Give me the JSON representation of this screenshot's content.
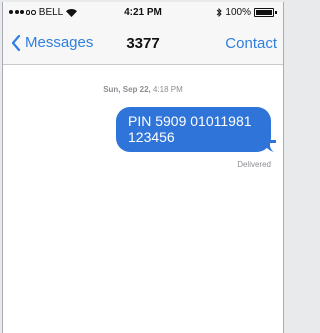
{
  "statusbar": {
    "carrier": "BELL",
    "time": "4:21 PM",
    "battery": "100%",
    "signal_bars": 3
  },
  "nav": {
    "back_label": "Messages",
    "title": "3377",
    "contact_label": "Contact"
  },
  "thread": {
    "timestamp_day": "Sun, Sep 22,",
    "timestamp_time": "4:18 PM",
    "messages": [
      {
        "text": "PIN 5909 01011981 123456",
        "status": "Delivered"
      }
    ]
  },
  "colors": {
    "accent": "#2f7fe0",
    "bubble": "#2f74d8",
    "meta_text": "#8e8e93"
  }
}
